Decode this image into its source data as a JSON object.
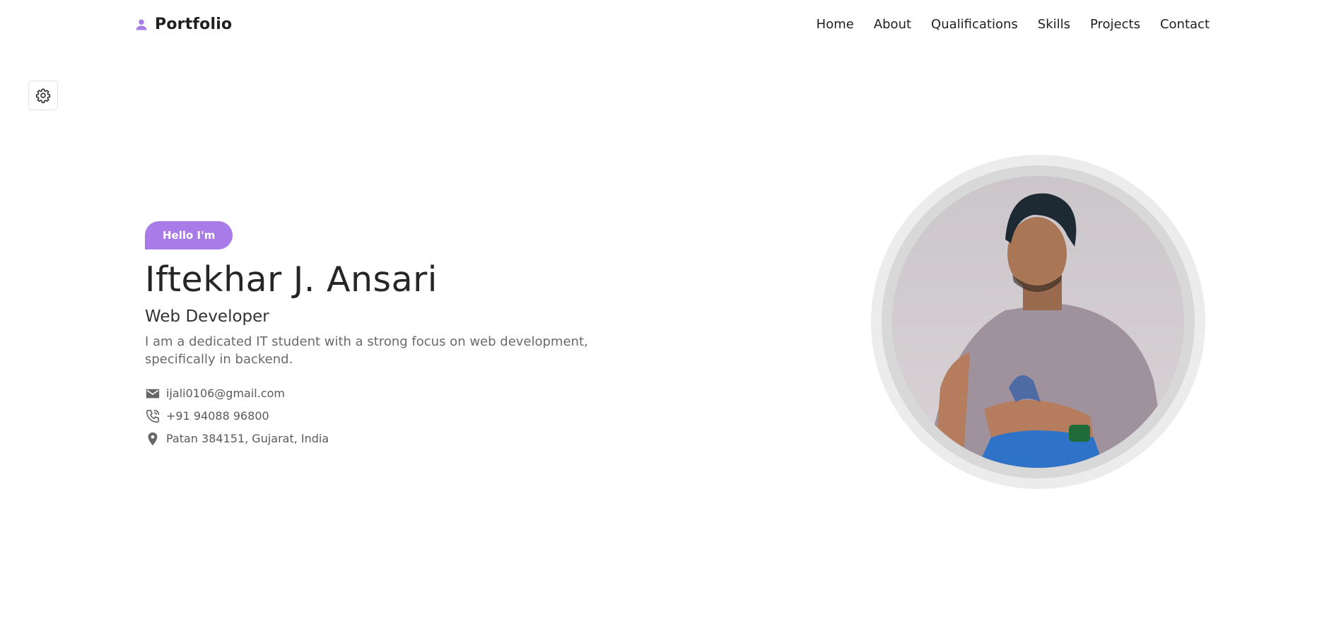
{
  "brand": {
    "name": "Portfolio",
    "icon": "person-icon",
    "accent_color": "#a87be8"
  },
  "nav": {
    "items": [
      {
        "label": "Home"
      },
      {
        "label": "About"
      },
      {
        "label": "Qualifications"
      },
      {
        "label": "Skills"
      },
      {
        "label": "Projects"
      },
      {
        "label": "Contact"
      }
    ]
  },
  "settings": {
    "icon": "gear-icon"
  },
  "hero": {
    "badge": "Hello I'm",
    "name": "Iftekhar J. Ansari",
    "role": "Web Developer",
    "bio": "I am a dedicated IT student with a strong focus on web development, specifically in backend.",
    "contacts": [
      {
        "icon": "mail-icon",
        "value": "ijali0106@gmail.com"
      },
      {
        "icon": "phone-icon",
        "value": "+91 94088 96800"
      },
      {
        "icon": "location-pin-icon",
        "value": "Patan 384151, Gujarat, India"
      }
    ]
  },
  "profile_photo": {
    "icon": "profile-photo"
  }
}
